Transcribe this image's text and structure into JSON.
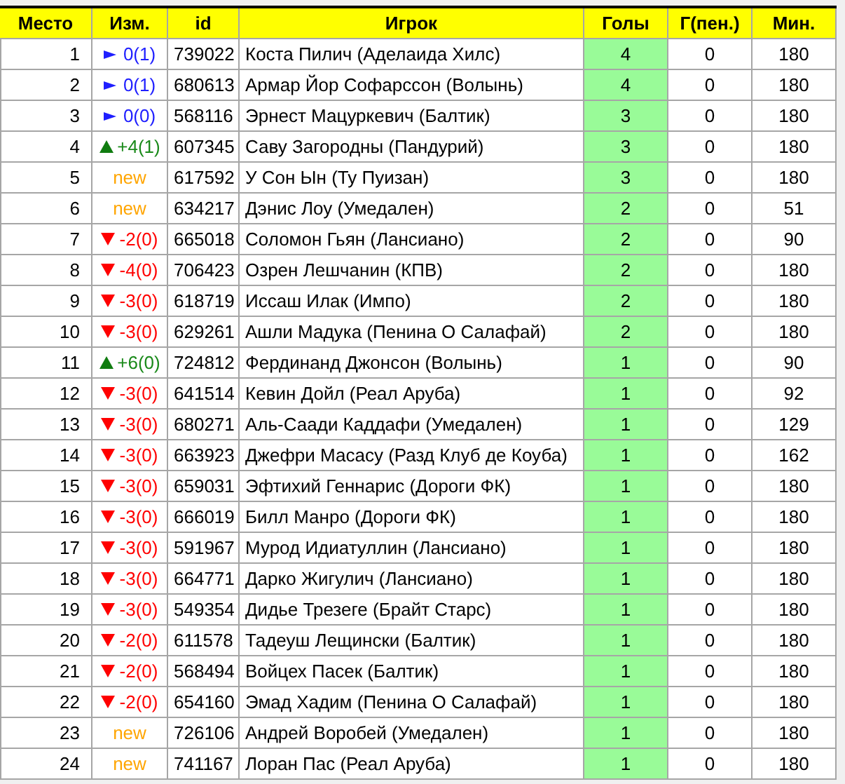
{
  "table": {
    "columns": [
      "Место",
      "Изм.",
      "id",
      "Игрок",
      "Голы",
      "Г(пен.)",
      "Мин."
    ],
    "rows": [
      {
        "place": "1",
        "change": {
          "kind": "same",
          "text": "0(1)"
        },
        "id": "739022",
        "player": "Коста Пилич (Аделаида Хилс)",
        "goals": "4",
        "penalty_goals": "0",
        "minutes": "180"
      },
      {
        "place": "2",
        "change": {
          "kind": "same",
          "text": "0(1)"
        },
        "id": "680613",
        "player": "Армар Йор Софарссон (Волынь)",
        "goals": "4",
        "penalty_goals": "0",
        "minutes": "180"
      },
      {
        "place": "3",
        "change": {
          "kind": "same",
          "text": "0(0)"
        },
        "id": "568116",
        "player": "Эрнест Мацуркевич (Балтик)",
        "goals": "3",
        "penalty_goals": "0",
        "minutes": "180"
      },
      {
        "place": "4",
        "change": {
          "kind": "up",
          "text": "+4(1)"
        },
        "id": "607345",
        "player": "Саву Загородны (Пандурий)",
        "goals": "3",
        "penalty_goals": "0",
        "minutes": "180"
      },
      {
        "place": "5",
        "change": {
          "kind": "new",
          "text": "new"
        },
        "id": "617592",
        "player": "У Сон Ын (Ту Пуизан)",
        "goals": "3",
        "penalty_goals": "0",
        "minutes": "180"
      },
      {
        "place": "6",
        "change": {
          "kind": "new",
          "text": "new"
        },
        "id": "634217",
        "player": "Дэнис Лоу (Умедален)",
        "goals": "2",
        "penalty_goals": "0",
        "minutes": "51"
      },
      {
        "place": "7",
        "change": {
          "kind": "down",
          "text": "-2(0)"
        },
        "id": "665018",
        "player": "Соломон Гьян (Лансиано)",
        "goals": "2",
        "penalty_goals": "0",
        "minutes": "90"
      },
      {
        "place": "8",
        "change": {
          "kind": "down",
          "text": "-4(0)"
        },
        "id": "706423",
        "player": "Озрен Лешчанин (КПВ)",
        "goals": "2",
        "penalty_goals": "0",
        "minutes": "180"
      },
      {
        "place": "9",
        "change": {
          "kind": "down",
          "text": "-3(0)"
        },
        "id": "618719",
        "player": "Иссаш Илак (Импо)",
        "goals": "2",
        "penalty_goals": "0",
        "minutes": "180"
      },
      {
        "place": "10",
        "change": {
          "kind": "down",
          "text": "-3(0)"
        },
        "id": "629261",
        "player": "Ашли Мадука (Пенина О Салафай)",
        "goals": "2",
        "penalty_goals": "0",
        "minutes": "180"
      },
      {
        "place": "11",
        "change": {
          "kind": "up",
          "text": "+6(0)"
        },
        "id": "724812",
        "player": "Фердинанд Джонсон (Волынь)",
        "goals": "1",
        "penalty_goals": "0",
        "minutes": "90"
      },
      {
        "place": "12",
        "change": {
          "kind": "down",
          "text": "-3(0)"
        },
        "id": "641514",
        "player": "Кевин Дойл (Реал Аруба)",
        "goals": "1",
        "penalty_goals": "0",
        "minutes": "92"
      },
      {
        "place": "13",
        "change": {
          "kind": "down",
          "text": "-3(0)"
        },
        "id": "680271",
        "player": "Аль-Саади Каддафи (Умедален)",
        "goals": "1",
        "penalty_goals": "0",
        "minutes": "129"
      },
      {
        "place": "14",
        "change": {
          "kind": "down",
          "text": "-3(0)"
        },
        "id": "663923",
        "player": "Джефри Масасу (Разд Клуб де Коуба)",
        "goals": "1",
        "penalty_goals": "0",
        "minutes": "162"
      },
      {
        "place": "15",
        "change": {
          "kind": "down",
          "text": "-3(0)"
        },
        "id": "659031",
        "player": "Эфтихий Геннарис (Дороги ФК)",
        "goals": "1",
        "penalty_goals": "0",
        "minutes": "180"
      },
      {
        "place": "16",
        "change": {
          "kind": "down",
          "text": "-3(0)"
        },
        "id": "666019",
        "player": "Билл Манро (Дороги ФК)",
        "goals": "1",
        "penalty_goals": "0",
        "minutes": "180"
      },
      {
        "place": "17",
        "change": {
          "kind": "down",
          "text": "-3(0)"
        },
        "id": "591967",
        "player": "Мурод Идиатуллин (Лансиано)",
        "goals": "1",
        "penalty_goals": "0",
        "minutes": "180"
      },
      {
        "place": "18",
        "change": {
          "kind": "down",
          "text": "-3(0)"
        },
        "id": "664771",
        "player": "Дарко Жигулич (Лансиано)",
        "goals": "1",
        "penalty_goals": "0",
        "minutes": "180"
      },
      {
        "place": "19",
        "change": {
          "kind": "down",
          "text": "-3(0)"
        },
        "id": "549354",
        "player": "Дидье Трезеге (Брайт Старс)",
        "goals": "1",
        "penalty_goals": "0",
        "minutes": "180"
      },
      {
        "place": "20",
        "change": {
          "kind": "down",
          "text": "-2(0)"
        },
        "id": "611578",
        "player": "Тадеуш Лещински (Балтик)",
        "goals": "1",
        "penalty_goals": "0",
        "minutes": "180"
      },
      {
        "place": "21",
        "change": {
          "kind": "down",
          "text": "-2(0)"
        },
        "id": "568494",
        "player": "Войцех Пасек (Балтик)",
        "goals": "1",
        "penalty_goals": "0",
        "minutes": "180"
      },
      {
        "place": "22",
        "change": {
          "kind": "down",
          "text": "-2(0)"
        },
        "id": "654160",
        "player": "Эмад Хадим (Пенина О Салафай)",
        "goals": "1",
        "penalty_goals": "0",
        "minutes": "180"
      },
      {
        "place": "23",
        "change": {
          "kind": "new",
          "text": "new"
        },
        "id": "726106",
        "player": "Андрей Воробей (Умедален)",
        "goals": "1",
        "penalty_goals": "0",
        "minutes": "180"
      },
      {
        "place": "24",
        "change": {
          "kind": "new",
          "text": "new"
        },
        "id": "741167",
        "player": "Лоран Пас (Реал Аруба)",
        "goals": "1",
        "penalty_goals": "0",
        "minutes": "180"
      }
    ]
  }
}
